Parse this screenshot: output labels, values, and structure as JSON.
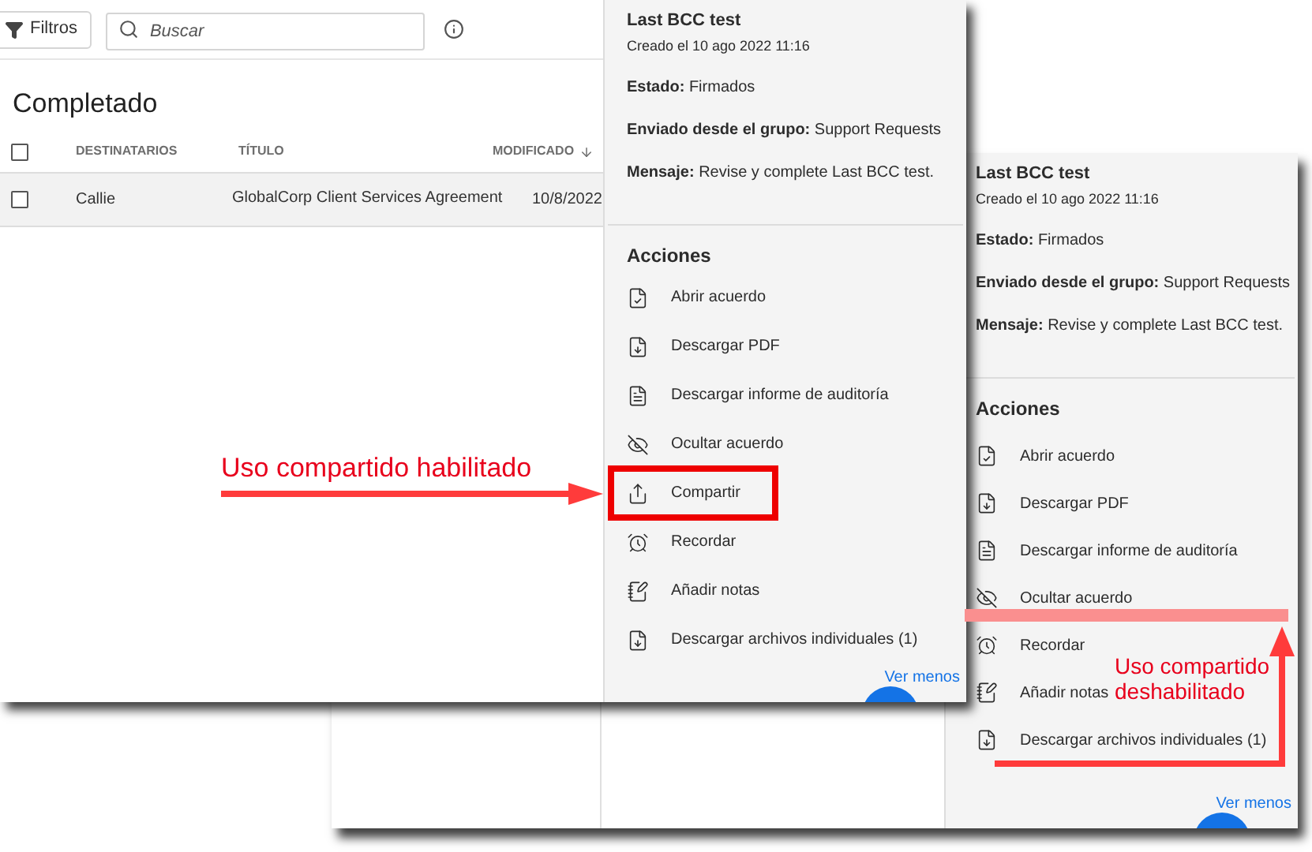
{
  "toolbar": {
    "filter_button": "Filtros",
    "search": {
      "placeholder": "Buscar"
    }
  },
  "list": {
    "title": "Completado",
    "all_checked": false,
    "columns": [
      "DESTINATARIOS",
      "TÍTULO",
      "MODIFICADO"
    ],
    "rows": [
      {
        "checked": false,
        "cells": [
          "Callie",
          "GlobalCorp Client Services Agreement",
          "10/8/2022"
        ]
      }
    ]
  },
  "panels": [
    {
      "title": "Last BCC test",
      "created": "Creado el 10 ago 2022 11:16",
      "details": [
        "**Estado:**  Firmados",
        "**Enviado desde el grupo:**  Support Requests",
        "**Mensaje:**  Revise y complete Last BCC test."
      ],
      "actions_title": "Acciones",
      "actions": [
        {
          "kind": "open",
          "label": "Abrir acuerdo",
          "highlighted": false
        },
        {
          "kind": "pdf",
          "label": "Descargar PDF",
          "highlighted": false
        },
        {
          "kind": "audit",
          "label": "Descargar informe de auditoría",
          "highlighted": false
        },
        {
          "kind": "hide",
          "label": "Ocultar acuerdo",
          "highlighted": false
        },
        {
          "kind": "share",
          "label": "Compartir",
          "highlighted": true
        },
        {
          "kind": "remind",
          "label": "Recordar",
          "highlighted": false
        },
        {
          "kind": "notes",
          "label": "Añadir notas",
          "highlighted": false
        },
        {
          "kind": "files",
          "label": "Descargar archivos individuales (1)",
          "highlighted": false
        }
      ],
      "more_link": "Ver menos"
    },
    {
      "title": "Last BCC test",
      "created": "Creado el 10 ago 2022 11:16",
      "details": [
        "**Estado:**  Firmados",
        "**Enviado desde el grupo:**  Support Requests",
        "**Mensaje:**  Revise y complete Last BCC test."
      ],
      "actions_title": "Acciones",
      "actions": [
        {
          "kind": "open",
          "label": "Abrir acuerdo",
          "highlighted": false
        },
        {
          "kind": "pdf",
          "label": "Descargar PDF",
          "highlighted": false
        },
        {
          "kind": "audit",
          "label": "Descargar informe de auditoría",
          "highlighted": false
        },
        {
          "kind": "hide",
          "label": "Ocultar acuerdo",
          "highlighted": false
        },
        {
          "kind": "remind",
          "label": "Recordar",
          "highlighted": false
        },
        {
          "kind": "notes",
          "label": "Añadir notas",
          "highlighted": false
        },
        {
          "kind": "files",
          "label": "Descargar archivos individuales (1)",
          "highlighted": false
        }
      ],
      "more_link": "Ver menos"
    }
  ],
  "annotations": [
    {
      "kind": "enabled",
      "text": "Uso compartido habilitado"
    },
    {
      "kind": "disabled",
      "text": "Uso compartido deshabilitado"
    }
  ]
}
